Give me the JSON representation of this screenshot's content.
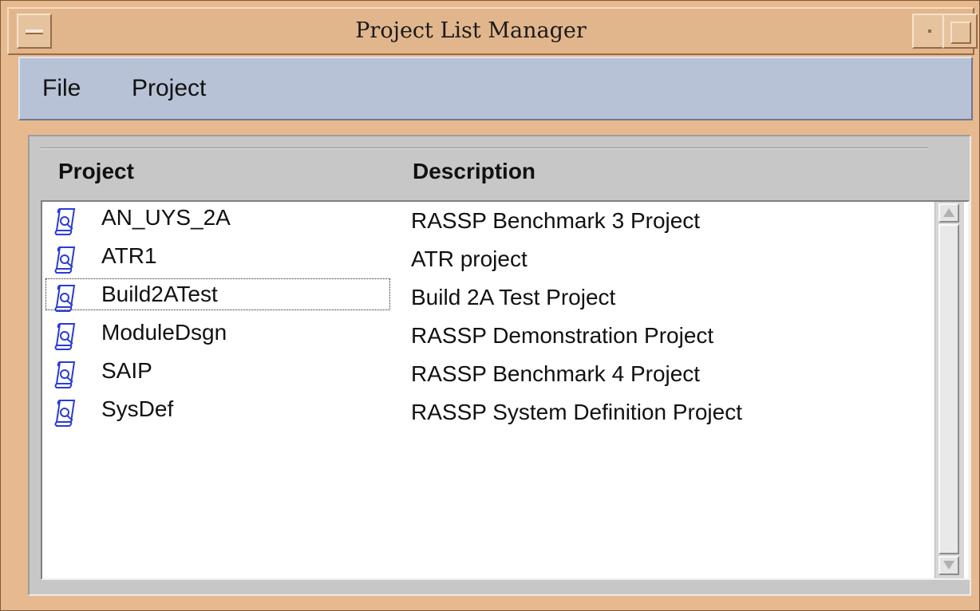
{
  "window": {
    "title": "Project List Manager"
  },
  "menu": {
    "file_label": "File",
    "project_label": "Project"
  },
  "table": {
    "columns": [
      "Project",
      "Description"
    ],
    "rows": [
      {
        "name": "AN_UYS_2A",
        "description": "RASSP Benchmark 3 Project",
        "icon": "project-scroll-icon"
      },
      {
        "name": "ATR1",
        "description": "ATR project",
        "icon": "project-scroll-icon"
      },
      {
        "name": "Build2ATest",
        "description": "Build 2A Test Project",
        "icon": "project-scroll-icon",
        "focused": true
      },
      {
        "name": "ModuleDsgn",
        "description": "RASSP Demonstration Project",
        "icon": "project-scroll-icon"
      },
      {
        "name": "SAIP",
        "description": "RASSP Benchmark 4 Project",
        "icon": "project-scroll-icon"
      },
      {
        "name": "SysDef",
        "description": "RASSP System Definition Project",
        "icon": "project-scroll-icon"
      }
    ]
  },
  "colors": {
    "titlebar": "#e2b68c",
    "menubar": "#b8c2d6",
    "panel": "#c7c7c7",
    "list_bg": "#ffffff",
    "icon_blue": "#2a3bd6"
  }
}
